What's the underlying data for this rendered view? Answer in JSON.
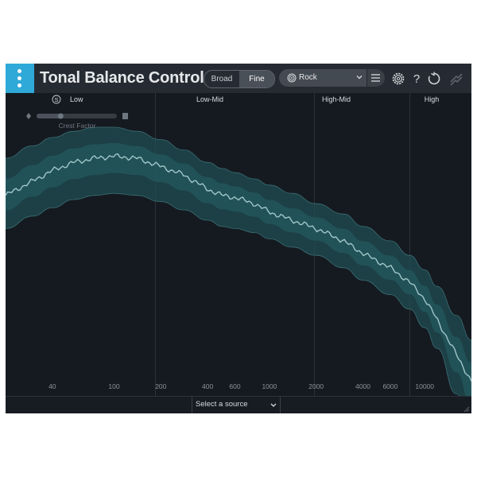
{
  "header": {
    "title": "Tonal Balance Control",
    "view_options": [
      "Broad",
      "Fine"
    ],
    "selected_view": "Fine",
    "target": "Rock",
    "icons": [
      "logo-icon",
      "target-icon",
      "chevron-down-icon",
      "menu-icon",
      "gear-icon",
      "help-icon",
      "refresh-icon",
      "ozone-logo-icon"
    ]
  },
  "bands": [
    "Low",
    "Low-Mid",
    "High-Mid",
    "High"
  ],
  "solo_label": "S",
  "crest": {
    "label": "Crest Factor",
    "level": 0.3
  },
  "freq_ticks": [
    "40",
    "100",
    "200",
    "400",
    "600",
    "1000",
    "2000",
    "4000",
    "6000",
    "10000"
  ],
  "curve": {
    "freqs": [
      20,
      30,
      40,
      55,
      75,
      100,
      140,
      200,
      280,
      400,
      500,
      600,
      800,
      1000,
      1400,
      2000,
      3000,
      4000,
      6000,
      8000,
      10000,
      12000,
      16000,
      20000
    ],
    "target_mid": [
      0.62,
      0.69,
      0.74,
      0.78,
      0.8,
      0.81,
      0.8,
      0.76,
      0.72,
      0.65,
      0.62,
      0.61,
      0.58,
      0.54,
      0.5,
      0.46,
      0.4,
      0.34,
      0.27,
      0.2,
      0.12,
      0.02,
      -0.15,
      -0.28
    ],
    "target_upper": [
      0.8,
      0.86,
      0.9,
      0.93,
      0.95,
      0.95,
      0.93,
      0.89,
      0.84,
      0.78,
      0.75,
      0.73,
      0.7,
      0.67,
      0.63,
      0.58,
      0.53,
      0.47,
      0.4,
      0.33,
      0.26,
      0.18,
      0.04,
      -0.08
    ],
    "target_lower": [
      0.46,
      0.52,
      0.56,
      0.6,
      0.62,
      0.63,
      0.62,
      0.59,
      0.55,
      0.5,
      0.47,
      0.46,
      0.44,
      0.41,
      0.37,
      0.33,
      0.27,
      0.21,
      0.14,
      0.07,
      -0.02,
      -0.12,
      -0.34,
      -0.55
    ]
  },
  "footer": {
    "source_label": "Select a source"
  },
  "colors": {
    "accent": "#2fa9d8",
    "background": "#151a21",
    "band_fill": "#1f5257",
    "curve": "#9fc6c8"
  }
}
